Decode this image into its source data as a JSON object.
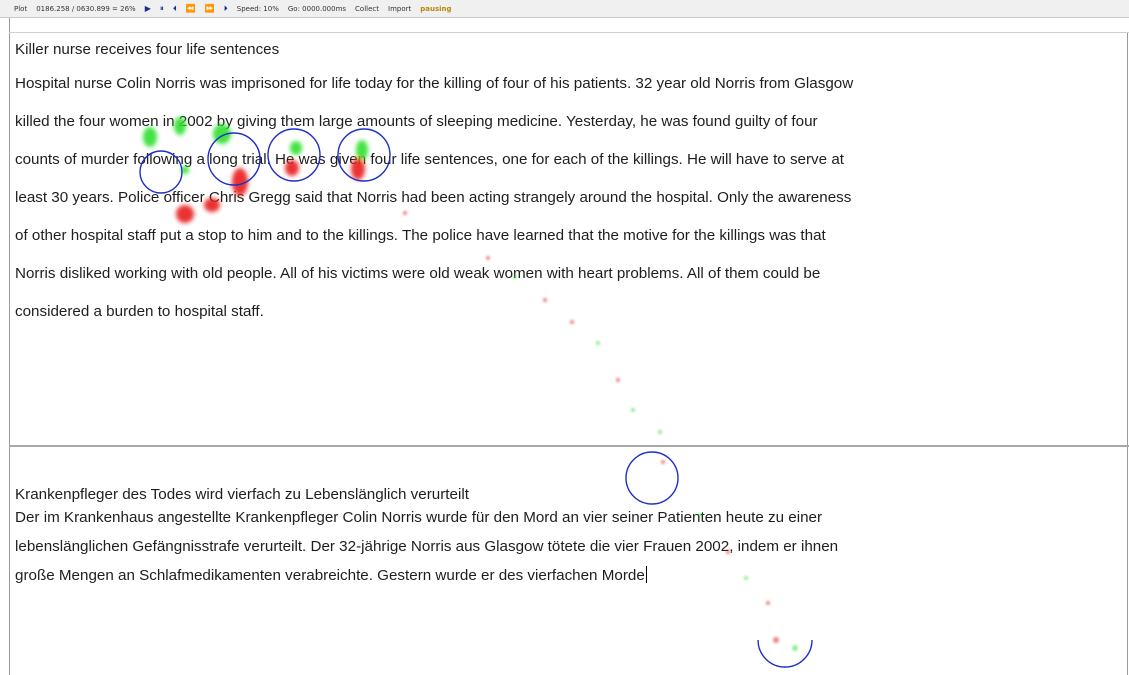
{
  "toolbar": {
    "plot_label": "Plot",
    "position_readout": "0186.258 / 0630.899 = 26%",
    "speed": "Speed: 10%",
    "goto": "Go: 0000.000ms",
    "collect_label": "Collect",
    "import_label": "Import",
    "status": "pausing",
    "controls": {
      "play": "▶",
      "pause": "⏸",
      "step_back": "⏴",
      "rewind": "⏪",
      "fast_forward": "⏩",
      "step_forward": "⏵"
    }
  },
  "english_text": {
    "title": "Killer nurse receives four life sentences",
    "lines": [
      "Hospital nurse Colin Norris was imprisoned for life today for the killing of four of his patients. 32 year old Norris from Glasgow",
      "killed the four women in 2002 by giving them large amounts of sleeping medicine. Yesterday, he was found guilty of four",
      "counts of murder following a long trial. He was given four life sentences, one for each of the killings. He will have to serve at",
      "least 30 years. Police officer Chris Gregg said that Norris had been acting strangely around the hospital. Only the awareness",
      "of other hospital staff put a stop to him and to the killings. The police have learned that the motive for the killings was that",
      "Norris disliked working with old people. All of his victims were old weak women with heart problems. All of them could be",
      "considered a burden to hospital staff."
    ]
  },
  "german_translation": {
    "title": "Krankenpfleger des Todes wird vierfach zu Lebenslänglich verurteilt",
    "lines": [
      "Der im Krankenhaus angestellte Krankenpfleger Colin Norris wurde für den Mord an vier seiner Patienten heute zu einer",
      "lebenslänglichen Gefängnisstrafe verurteilt. Der 32-jährige Norris aus Glasgow tötete die vier Frauen 2002, indem er ihnen",
      "große Mengen an Schlafmedikamenten verabreichte. Gestern wurde er des vierfachen Morde"
    ]
  },
  "colors": {
    "fixation_circle": "#1c2fc8",
    "gaze_green": "#2ee02e",
    "gaze_red": "#e81a1a",
    "status": "#b8860b"
  }
}
